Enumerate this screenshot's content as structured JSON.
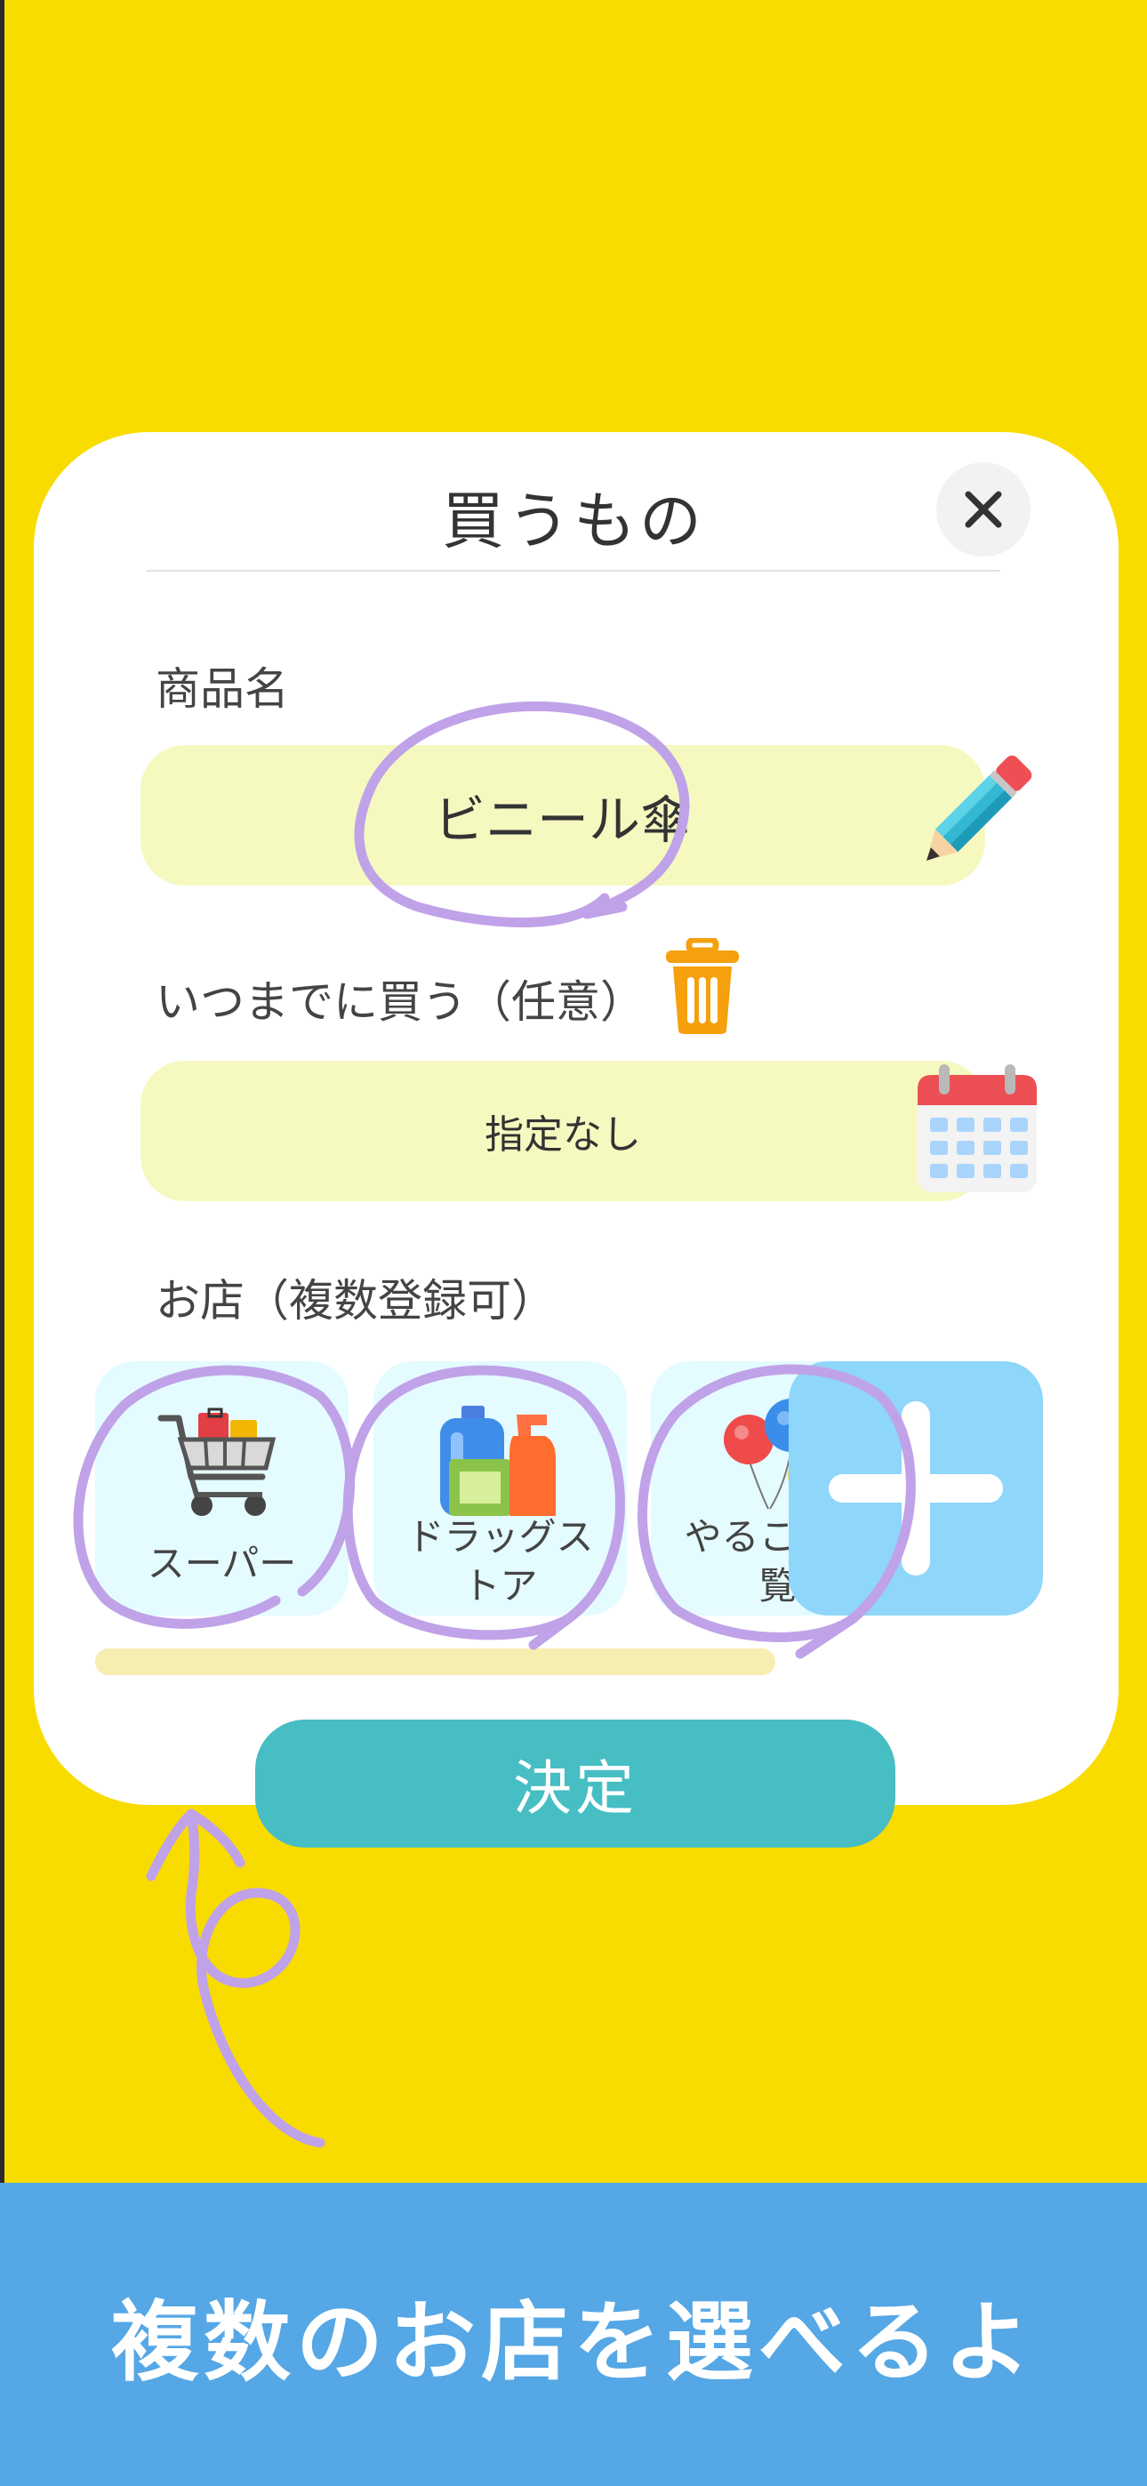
{
  "dialog": {
    "title": "買うもの",
    "close_label": "✕"
  },
  "product": {
    "label": "商品名",
    "value": "ビニール傘"
  },
  "deadline": {
    "label": "いつまでに買う（任意）",
    "value": "指定なし"
  },
  "stores": {
    "label": "お店（複数登録可）",
    "items": [
      {
        "label": "スーパー",
        "icon": "shopping-cart-icon"
      },
      {
        "label": "ドラッグストア",
        "icon": "detergent-bottles-icon"
      },
      {
        "label": "やること一覧",
        "icon": "balloons-icon"
      }
    ],
    "add_icon": "plus-icon"
  },
  "confirm_label": "決定",
  "banner": {
    "text": "複数のお店を選べるよ"
  },
  "colors": {
    "background": "#f8dc00",
    "field": "#f5f9c0",
    "store_tile": "#e4fbff",
    "add_button": "#8fd6fb",
    "confirm": "#46bec3",
    "banner": "#55a7e5",
    "annotation": "#c0a2e8"
  }
}
